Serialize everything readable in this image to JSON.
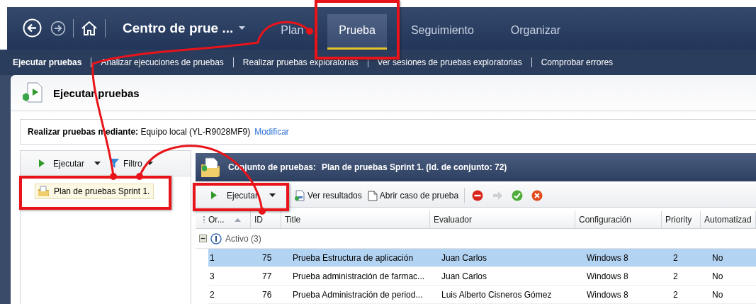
{
  "nav": {
    "title": "Centro de prue ...",
    "tabs": [
      {
        "label": "Plan",
        "selected": false,
        "annotated": false
      },
      {
        "label": "Prueba",
        "selected": true,
        "annotated": true
      },
      {
        "label": "Seguimiento",
        "selected": false,
        "annotated": false
      },
      {
        "label": "Organizar",
        "selected": false,
        "annotated": false
      }
    ]
  },
  "subnav": [
    {
      "label": "Ejecutar pruebas",
      "selected": true
    },
    {
      "label": "Analizar ejecuciones de pruebas",
      "selected": false
    },
    {
      "label": "Realizar pruebas exploratorias",
      "selected": false
    },
    {
      "label": "Ver sesiones de pruebas exploratorias",
      "selected": false
    },
    {
      "label": "Comprobar errores",
      "selected": false
    }
  ],
  "page_title": "Ejecutar pruebas",
  "run_with": {
    "label": "Realizar pruebas mediante:",
    "value": "Equipo local (YL-R9028MF9)",
    "link": "Modificar"
  },
  "left_panel": {
    "run_button": "Ejecutar",
    "filter_button": "Filtro",
    "tree": [
      {
        "label": "Plan de pruebas Sprint 1.",
        "selected": true,
        "annotated": true
      }
    ]
  },
  "suite": {
    "label": "Conjunto de pruebas:",
    "value": "Plan de pruebas Sprint 1. (Id. de conjunto: 72)",
    "toolbar": {
      "run_button": {
        "label": "Ejecutar",
        "annotated": true
      },
      "buttons": [
        "Ver resultados",
        "Abrir caso de prueba"
      ],
      "icon_buttons": [
        {
          "kind": "blocked",
          "disabled": false
        },
        {
          "kind": "forward",
          "disabled": true
        },
        {
          "kind": "passed",
          "disabled": false
        },
        {
          "kind": "failed",
          "disabled": false
        }
      ]
    },
    "columns": [
      {
        "label": "Or...",
        "sorted": true
      },
      {
        "label": "ID",
        "sorted": false
      },
      {
        "label": "Title",
        "sorted": false
      },
      {
        "label": "Evaluador",
        "sorted": false
      },
      {
        "label": "Configuración",
        "sorted": false
      },
      {
        "label": "Priority",
        "sorted": false
      },
      {
        "label": "Automatizad",
        "sorted": false
      }
    ],
    "group": {
      "label": "Activo (3)",
      "expanded": true
    },
    "rows": [
      {
        "selected": true,
        "cells": [
          "1",
          "75",
          "Prueba Estructura de aplicación",
          "Juan Carlos",
          "Windows 8",
          "2",
          "No"
        ]
      },
      {
        "selected": false,
        "cells": [
          "3",
          "77",
          "Prueba administración de farmac...",
          "Juan Carlos",
          "Windows 8",
          "2",
          "No"
        ]
      },
      {
        "selected": false,
        "cells": [
          "2",
          "76",
          "Prueba Administración de period...",
          "Luis Alberto Cisneros Gómez",
          "Windows 8",
          "2",
          "No"
        ]
      }
    ]
  }
}
